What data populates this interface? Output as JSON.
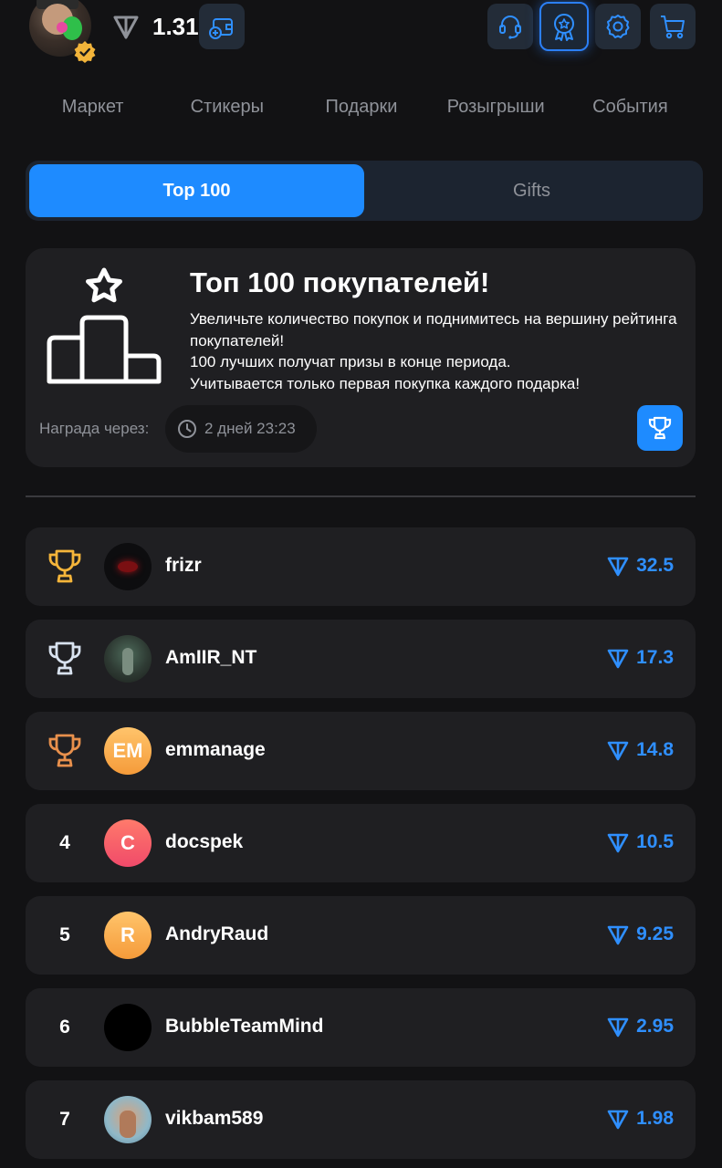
{
  "header": {
    "balance": "1.31",
    "icons": [
      "ton-icon",
      "wallet-add-icon",
      "support-icon",
      "award-icon",
      "settings-icon",
      "cart-icon"
    ]
  },
  "nav": {
    "items": [
      "Маркет",
      "Стикеры",
      "Подарки",
      "Розыгрыши",
      "События"
    ]
  },
  "tabs": {
    "top100": "Top 100",
    "gifts": "Gifts"
  },
  "info": {
    "title": "Топ 100 покупателей!",
    "line1": "Увеличьте количество покупок и поднимитесь на вершину рейтинга покупателей!",
    "line2": "100 лучших получат призы в конце периода.",
    "line3": "Учитывается только первая покупка каждого подарка!",
    "reward_label": "Награда через:",
    "timer": "2 дней 23:23"
  },
  "colors": {
    "accent": "#1e8bff",
    "gold": "#f5b53a",
    "silver": "#d8e2ef",
    "bronze": "#e8904c",
    "amount": "#2f8fff"
  },
  "leaders": [
    {
      "rank": "",
      "medal": "gold",
      "initials": "",
      "name": "frizr",
      "amount": "32.5"
    },
    {
      "rank": "",
      "medal": "silver",
      "initials": "",
      "name": "AmIIR_NT",
      "amount": "17.3"
    },
    {
      "rank": "",
      "medal": "bronze",
      "initials": "EM",
      "name": "emmanage",
      "amount": "14.8"
    },
    {
      "rank": "4",
      "medal": "",
      "initials": "C",
      "name": "docspek",
      "amount": "10.5"
    },
    {
      "rank": "5",
      "medal": "",
      "initials": "R",
      "name": "AndryRaud",
      "amount": "9.25"
    },
    {
      "rank": "6",
      "medal": "",
      "initials": "",
      "name": "BubbleTeamMind",
      "amount": "2.95"
    },
    {
      "rank": "7",
      "medal": "",
      "initials": "",
      "name": "vikbam589",
      "amount": "1.98"
    }
  ]
}
